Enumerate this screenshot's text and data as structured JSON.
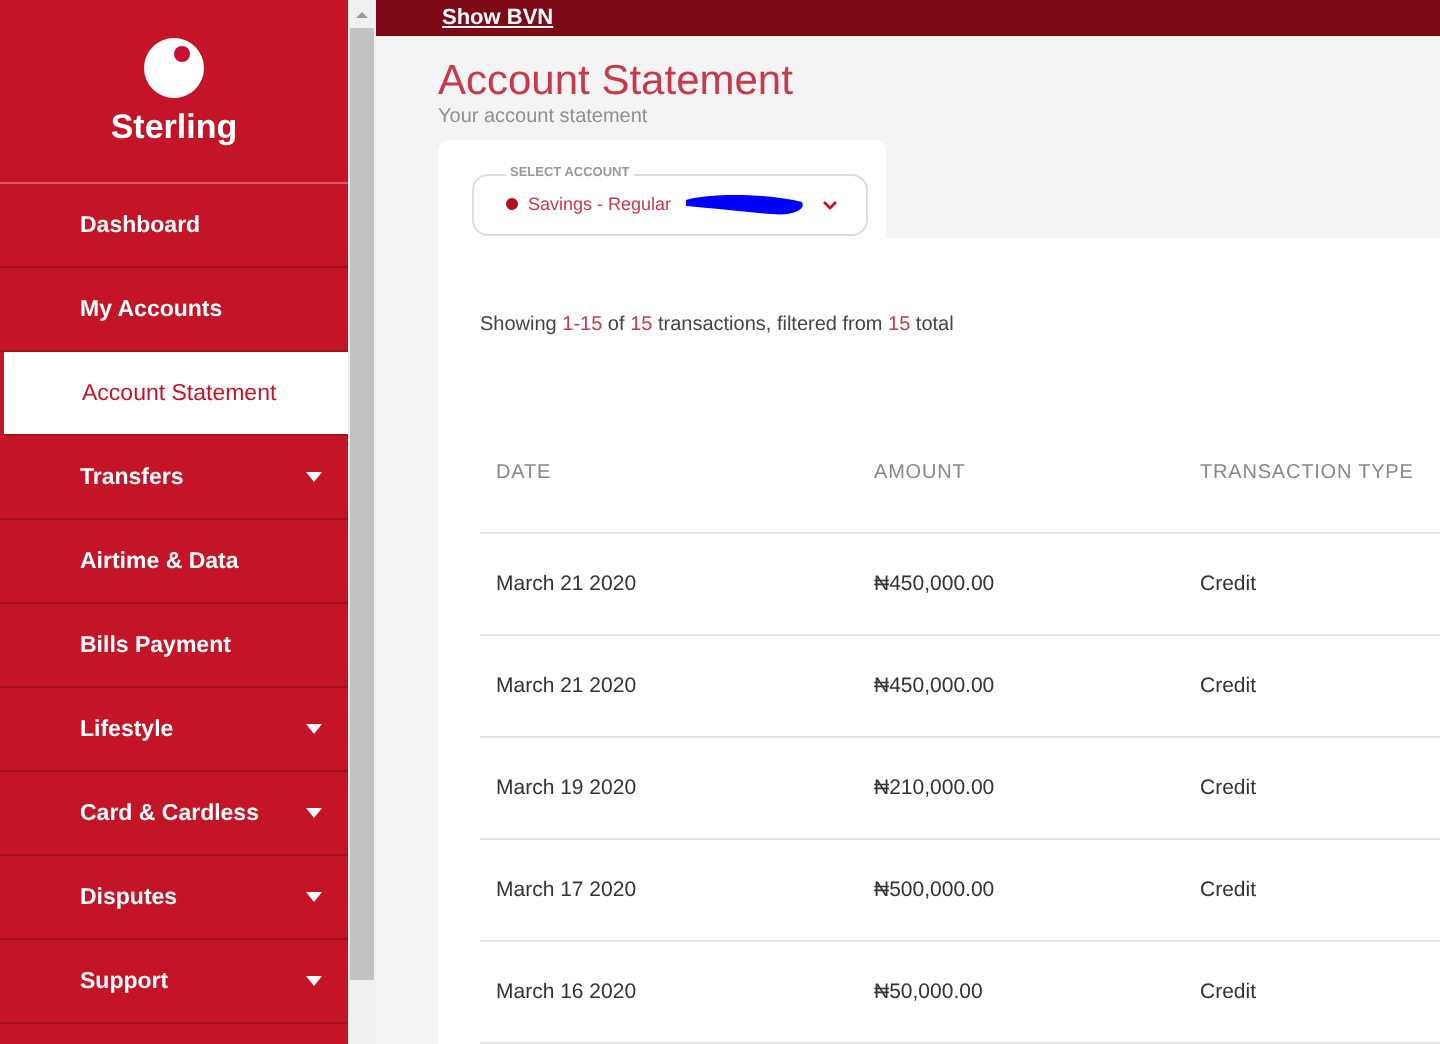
{
  "top_bar": {
    "link": "Show BVN"
  },
  "brand": {
    "name": "Sterling"
  },
  "sidebar": {
    "items": [
      {
        "label": "Dashboard",
        "selected": false,
        "has_submenu": false
      },
      {
        "label": "My Accounts",
        "selected": false,
        "has_submenu": false
      },
      {
        "label": "Account Statement",
        "selected": true,
        "has_submenu": false
      },
      {
        "label": "Transfers",
        "selected": false,
        "has_submenu": true
      },
      {
        "label": "Airtime & Data",
        "selected": false,
        "has_submenu": false
      },
      {
        "label": "Bills Payment",
        "selected": false,
        "has_submenu": false
      },
      {
        "label": "Lifestyle",
        "selected": false,
        "has_submenu": true
      },
      {
        "label": "Card & Cardless",
        "selected": false,
        "has_submenu": true
      },
      {
        "label": "Disputes",
        "selected": false,
        "has_submenu": true
      },
      {
        "label": "Support",
        "selected": false,
        "has_submenu": true
      }
    ]
  },
  "page": {
    "title": "Account Statement",
    "subtitle": "Your account statement"
  },
  "account_select": {
    "label": "SELECT ACCOUNT",
    "value": "Savings - Regular",
    "redacted": true
  },
  "summary": [
    {
      "text": "Showing ",
      "highlight": false
    },
    {
      "text": "1-15",
      "highlight": true
    },
    {
      "text": " of ",
      "highlight": false
    },
    {
      "text": "15",
      "highlight": true
    },
    {
      "text": " transactions, filtered from ",
      "highlight": false
    },
    {
      "text": "15",
      "highlight": true
    },
    {
      "text": " total",
      "highlight": false
    }
  ],
  "table": {
    "columns": [
      "DATE",
      "AMOUNT",
      "TRANSACTION TYPE"
    ],
    "rows": [
      [
        "March 21 2020",
        "₦450,000.00",
        "Credit"
      ],
      [
        "March 21 2020",
        "₦450,000.00",
        "Credit"
      ],
      [
        "March 19 2020",
        "₦210,000.00",
        "Credit"
      ],
      [
        "March 17 2020",
        "₦500,000.00",
        "Credit"
      ],
      [
        "March 16 2020",
        "₦50,000.00",
        "Credit"
      ]
    ]
  }
}
